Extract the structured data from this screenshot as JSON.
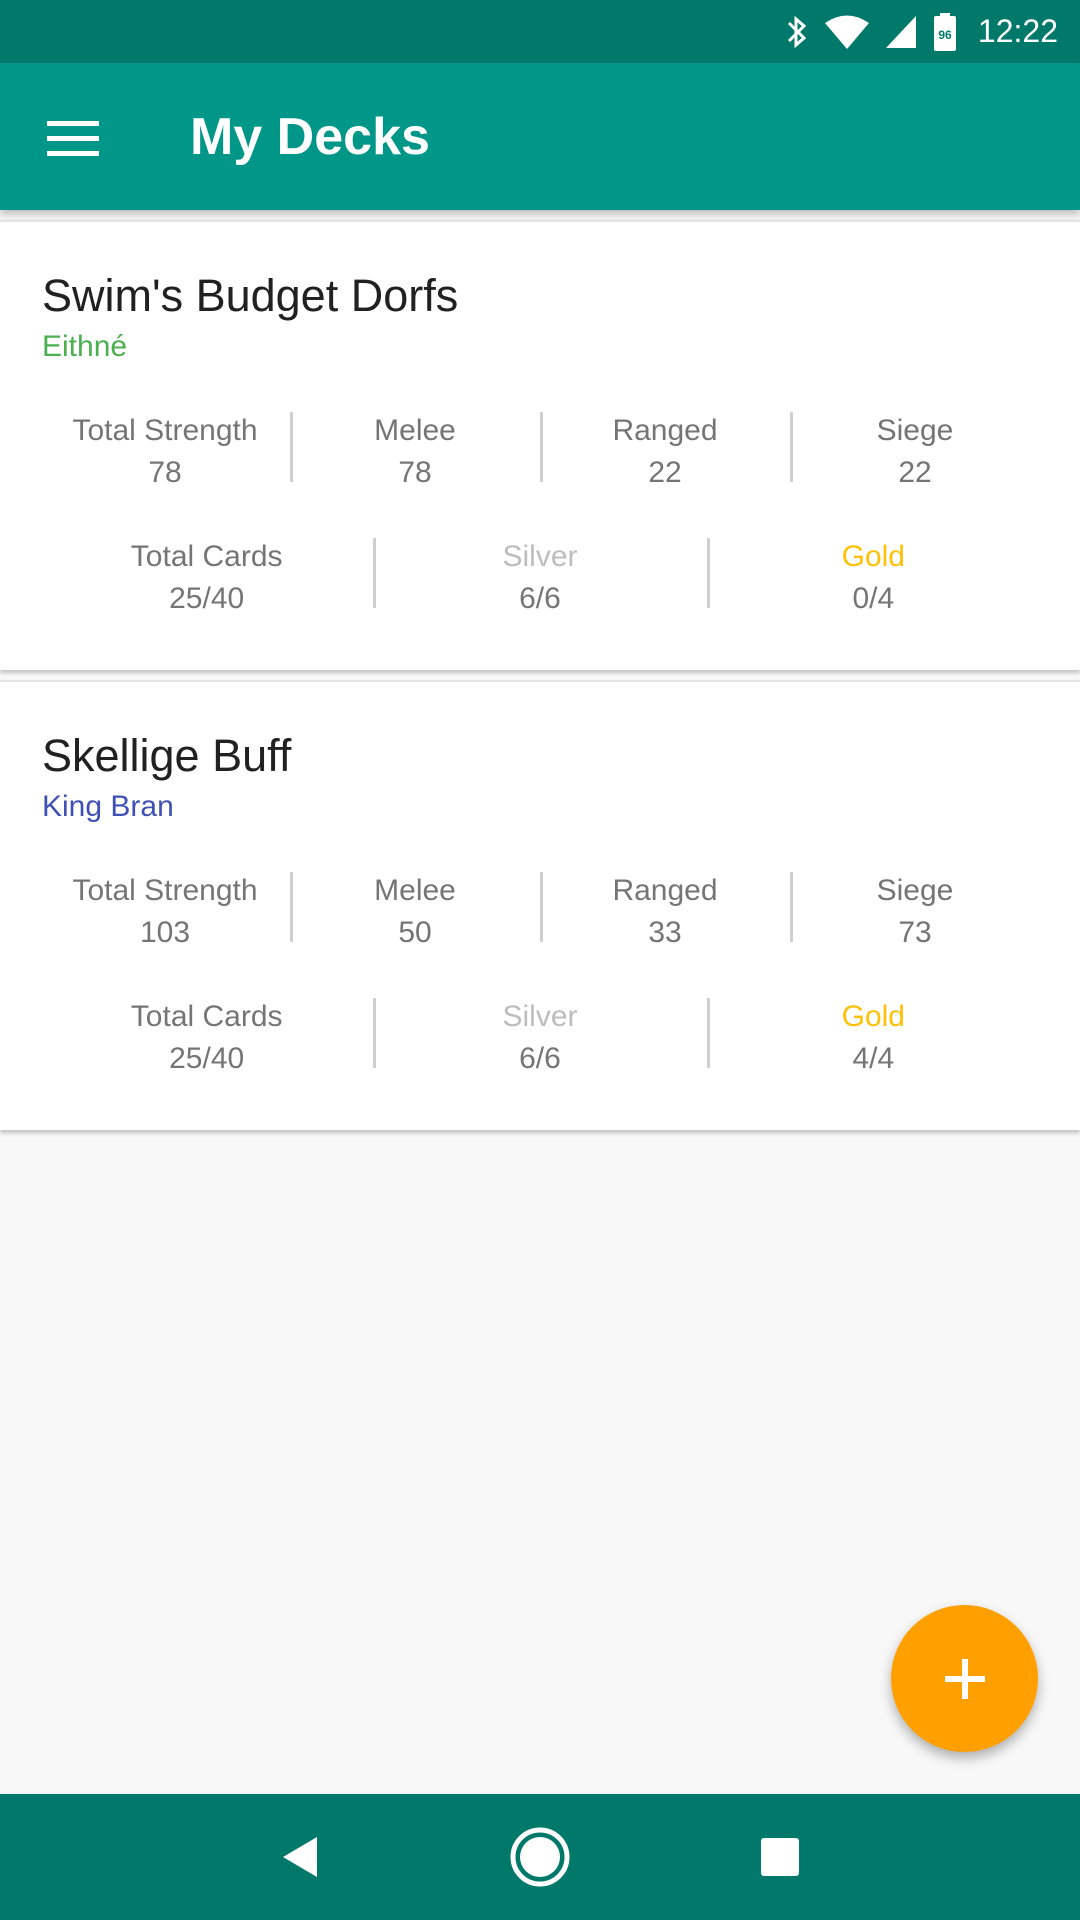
{
  "status_bar": {
    "time": "12:22",
    "battery_level": "96",
    "icons": [
      "bluetooth-icon",
      "wifi-icon",
      "cell-signal-icon",
      "battery-icon"
    ]
  },
  "app_bar": {
    "title": "My Decks",
    "menu_icon": "hamburger-menu-icon"
  },
  "decks": [
    {
      "name": "Swim's Budget Dorfs",
      "leader": "Eithné",
      "leader_color": "#4caf50",
      "strength_labels": [
        "Total Strength",
        "Melee",
        "Ranged",
        "Siege"
      ],
      "strength_values": [
        "78",
        "78",
        "22",
        "22"
      ],
      "card_labels": [
        "Total Cards",
        "Silver",
        "Gold"
      ],
      "card_values": [
        "25/40",
        "6/6",
        "0/4"
      ]
    },
    {
      "name": "Skellige Buff",
      "leader": "King Bran",
      "leader_color": "#3f51b5",
      "strength_labels": [
        "Total Strength",
        "Melee",
        "Ranged",
        "Siege"
      ],
      "strength_values": [
        "103",
        "50",
        "33",
        "73"
      ],
      "card_labels": [
        "Total Cards",
        "Silver",
        "Gold"
      ],
      "card_values": [
        "25/40",
        "6/6",
        "4/4"
      ]
    }
  ],
  "fab": {
    "icon": "plus-icon",
    "color": "#ffa000"
  },
  "nav_bar": {
    "icons": [
      "back-icon",
      "home-icon",
      "recents-icon"
    ]
  },
  "colors": {
    "primary": "#009688",
    "primary_dark": "#00796b",
    "gold": "#ffc107",
    "silver": "#bdbdbd"
  }
}
